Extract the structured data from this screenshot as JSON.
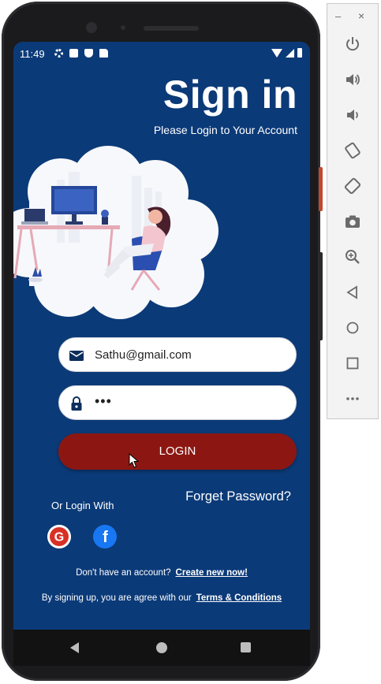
{
  "status_bar": {
    "time": "11:49"
  },
  "header": {
    "title": "Sign in",
    "subtitle": "Please Login to Your Account"
  },
  "form": {
    "email_value": "Sathu@gmail.com",
    "password_value": "•••",
    "login_label": "LOGIN"
  },
  "links": {
    "forget_password": "Forget Password?",
    "or_login_with": "Or Login With"
  },
  "social": {
    "google_letter": "G",
    "facebook_letter": "f"
  },
  "footer": {
    "no_account": "Don't have an account?",
    "create_account": "Create new now!",
    "agree_text": "By signing up, you are agree with our",
    "terms": "Terms & Conditions"
  },
  "emulator": {
    "minimize": "–",
    "close": "×",
    "buttons": [
      "power-icon",
      "volume-up-icon",
      "volume-down-icon",
      "rotate-left-icon",
      "rotate-right-icon",
      "camera-icon",
      "zoom-icon",
      "back-icon",
      "home-icon",
      "overview-icon",
      "more-icon"
    ]
  },
  "colors": {
    "screen_bg": "#0b3a78",
    "login_button": "#8c1712",
    "input_bg": "#ffffff",
    "icon_navy": "#0b2e5c"
  }
}
